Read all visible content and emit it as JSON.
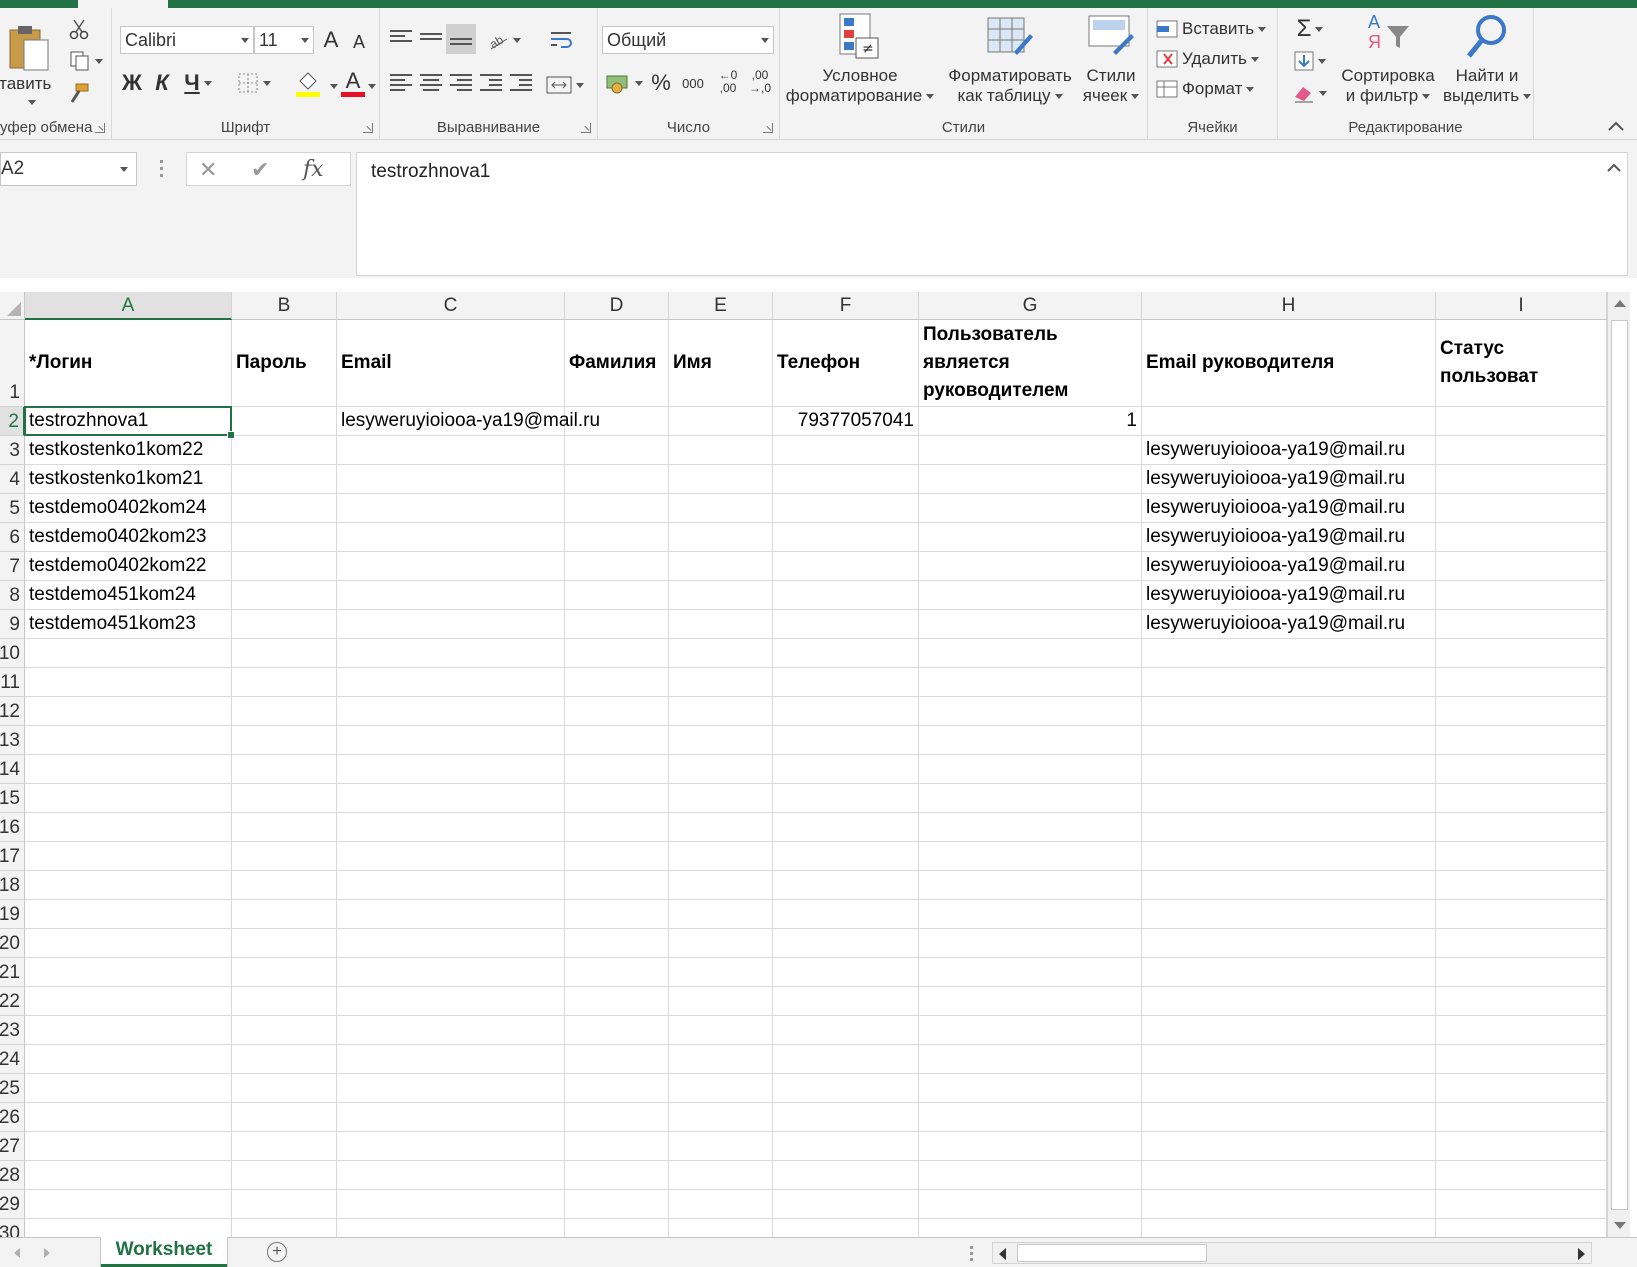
{
  "ribbon": {
    "clipboard": {
      "paste_label": "ставить",
      "group_label": "уфер обмена"
    },
    "font": {
      "font_name": "Calibri",
      "font_size": "11",
      "bold": "Ж",
      "italic": "К",
      "underline": "Ч",
      "group_label": "Шрифт",
      "grow": "A",
      "shrink": "A",
      "font_color_letter": "A"
    },
    "alignment": {
      "group_label": "Выравнивание"
    },
    "number": {
      "format": "Общий",
      "percent": "%",
      "thousands": "000",
      "inc_decimal_top": "←0",
      "inc_decimal_bottom": ",00",
      "dec_decimal_top": ",00",
      "dec_decimal_bottom": "→,0",
      "group_label": "Число"
    },
    "styles": {
      "conditional_line1": "Условное",
      "conditional_line2": "форматирование",
      "table_line1": "Форматировать",
      "table_line2": "как таблицу",
      "cell_styles_line1": "Стили",
      "cell_styles_line2": "ячеек",
      "group_label": "Стили"
    },
    "cells": {
      "insert": "Вставить",
      "delete": "Удалить",
      "format": "Формат",
      "group_label": "Ячейки"
    },
    "editing": {
      "sum_symbol": "Σ",
      "sort_line1": "Сортировка",
      "sort_line2": "и фильтр",
      "find_line1": "Найти и",
      "find_line2": "выделить",
      "sort_letter_a": "А",
      "sort_letter_ya": "Я",
      "group_label": "Редактирование"
    }
  },
  "formula_bar": {
    "name_box": "A2",
    "cancel": "✕",
    "enter": "✔",
    "fx": "fx",
    "content": "testrozhnova1"
  },
  "grid": {
    "columns": [
      "A",
      "B",
      "C",
      "D",
      "E",
      "F",
      "G",
      "H",
      "I"
    ],
    "row_numbers": [
      "1",
      "2",
      "3",
      "4",
      "5",
      "6",
      "7",
      "8",
      "9",
      "10",
      "11",
      "12",
      "13",
      "14",
      "15",
      "16",
      "17",
      "18",
      "19",
      "20",
      "21",
      "22",
      "23",
      "24",
      "25",
      "26",
      "27",
      "28",
      "29",
      "30"
    ],
    "headers": {
      "A": "*Логин",
      "B": "Пароль",
      "C": "Email",
      "D": "Фамилия",
      "E": "Имя",
      "F": "Телефон",
      "G": "Пользователь является руководителем",
      "H": "Email руководителя",
      "I": "Статус пользоват"
    },
    "rows": [
      {
        "A": "testrozhnova1",
        "C": "lesyweruyioiooa-ya19@mail.ru",
        "F": "79377057041",
        "G": "1",
        "H": ""
      },
      {
        "A": "testkostenko1kom22",
        "H": "lesyweruyioiooa-ya19@mail.ru"
      },
      {
        "A": "testkostenko1kom21",
        "H": "lesyweruyioiooa-ya19@mail.ru"
      },
      {
        "A": "testdemo0402kom24",
        "H": "lesyweruyioiooa-ya19@mail.ru"
      },
      {
        "A": "testdemo0402kom23",
        "H": "lesyweruyioiooa-ya19@mail.ru"
      },
      {
        "A": "testdemo0402kom22",
        "H": "lesyweruyioiooa-ya19@mail.ru"
      },
      {
        "A": "testdemo451kom24",
        "H": "lesyweruyioiooa-ya19@mail.ru"
      },
      {
        "A": "testdemo451kom23",
        "H": "lesyweruyioiooa-ya19@mail.ru"
      }
    ],
    "selected_cell": "A2"
  },
  "sheets": {
    "active": "Worksheet",
    "add_symbol": "+"
  },
  "colors": {
    "accent": "#217346",
    "font_color": "#e81123",
    "highlight": "#ffff00"
  }
}
